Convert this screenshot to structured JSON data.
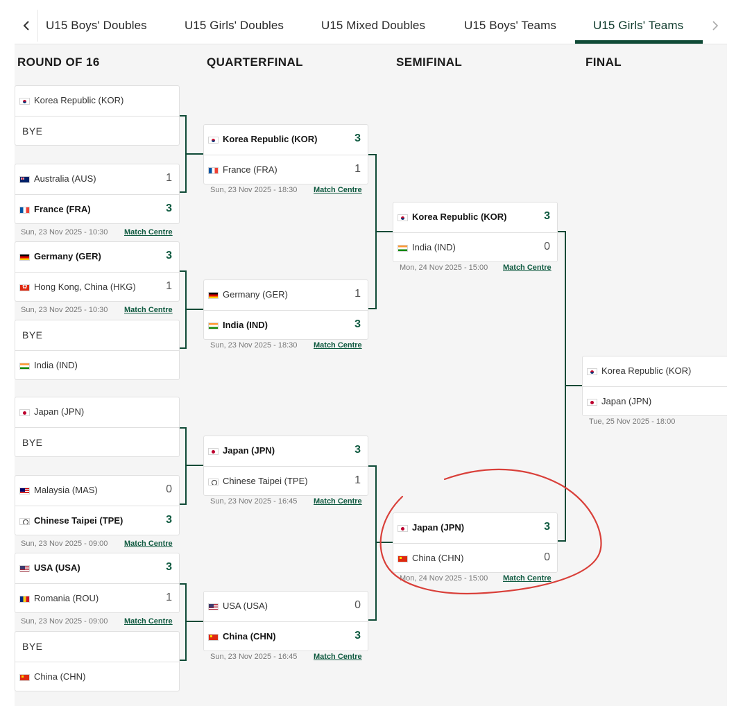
{
  "tabs": {
    "items": [
      {
        "label": "U15 Boys' Doubles",
        "active": false
      },
      {
        "label": "U15 Girls' Doubles",
        "active": false
      },
      {
        "label": "U15 Mixed Doubles",
        "active": false
      },
      {
        "label": "U15 Boys' Teams",
        "active": false
      },
      {
        "label": "U15 Girls' Teams",
        "active": true
      }
    ],
    "prev_icon": "chevron-left-icon",
    "next_icon": "chevron-right-icon"
  },
  "rounds": {
    "r16": "ROUND OF 16",
    "qf": "QUARTERFINAL",
    "sf": "SEMIFINAL",
    "final": "FINAL"
  },
  "match_centre_label": "Match Centre",
  "bye_label": "BYE",
  "r16_matches": [
    {
      "team1": "Korea Republic (KOR)",
      "flag1": "kor",
      "score1": "",
      "team2": "BYE",
      "flag2": "",
      "score2": "",
      "winner": 1,
      "date": "",
      "link": false
    },
    {
      "team1": "Australia (AUS)",
      "flag1": "aus",
      "score1": "1",
      "team2": "France (FRA)",
      "flag2": "fra",
      "score2": "3",
      "winner": 2,
      "date": "Sun, 23 Nov 2025 - 10:30",
      "link": true
    },
    {
      "team1": "Germany (GER)",
      "flag1": "ger",
      "score1": "3",
      "team2": "Hong Kong, China (HKG)",
      "flag2": "hkg",
      "score2": "1",
      "winner": 1,
      "date": "Sun, 23 Nov 2025 - 10:30",
      "link": true
    },
    {
      "team1": "BYE",
      "flag1": "",
      "score1": "",
      "team2": "India (IND)",
      "flag2": "ind",
      "score2": "",
      "winner": 2,
      "date": "",
      "link": false
    },
    {
      "team1": "Japan (JPN)",
      "flag1": "jpn",
      "score1": "",
      "team2": "BYE",
      "flag2": "",
      "score2": "",
      "winner": 1,
      "date": "",
      "link": false
    },
    {
      "team1": "Malaysia (MAS)",
      "flag1": "mas",
      "score1": "0",
      "team2": "Chinese Taipei (TPE)",
      "flag2": "tpe",
      "score2": "3",
      "winner": 2,
      "date": "Sun, 23 Nov 2025 - 09:00",
      "link": true
    },
    {
      "team1": "USA (USA)",
      "flag1": "usa",
      "score1": "3",
      "team2": "Romania (ROU)",
      "flag2": "rou",
      "score2": "1",
      "winner": 1,
      "date": "Sun, 23 Nov 2025 - 09:00",
      "link": true
    },
    {
      "team1": "BYE",
      "flag1": "",
      "score1": "",
      "team2": "China (CHN)",
      "flag2": "chn",
      "score2": "",
      "winner": 2,
      "date": "",
      "link": false
    }
  ],
  "qf_matches": [
    {
      "team1": "Korea Republic (KOR)",
      "flag1": "kor",
      "score1": "3",
      "team2": "France (FRA)",
      "flag2": "fra",
      "score2": "1",
      "winner": 1,
      "date": "Sun, 23 Nov 2025 - 18:30",
      "link": true
    },
    {
      "team1": "Germany (GER)",
      "flag1": "ger",
      "score1": "1",
      "team2": "India (IND)",
      "flag2": "ind",
      "score2": "3",
      "winner": 2,
      "date": "Sun, 23 Nov 2025 - 18:30",
      "link": true
    },
    {
      "team1": "Japan (JPN)",
      "flag1": "jpn",
      "score1": "3",
      "team2": "Chinese Taipei (TPE)",
      "flag2": "tpe",
      "score2": "1",
      "winner": 1,
      "date": "Sun, 23 Nov 2025 - 16:45",
      "link": true
    },
    {
      "team1": "USA (USA)",
      "flag1": "usa",
      "score1": "0",
      "team2": "China (CHN)",
      "flag2": "chn",
      "score2": "3",
      "winner": 2,
      "date": "Sun, 23 Nov 2025 - 16:45",
      "link": true
    }
  ],
  "sf_matches": [
    {
      "team1": "Korea Republic (KOR)",
      "flag1": "kor",
      "score1": "3",
      "team2": "India (IND)",
      "flag2": "ind",
      "score2": "0",
      "winner": 1,
      "date": "Mon, 24 Nov 2025 - 15:00",
      "link": true
    },
    {
      "team1": "Japan (JPN)",
      "flag1": "jpn",
      "score1": "3",
      "team2": "China (CHN)",
      "flag2": "chn",
      "score2": "0",
      "winner": 1,
      "date": "Mon, 24 Nov 2025 - 15:00",
      "link": true
    }
  ],
  "final_match": {
    "team1": "Korea Republic (KOR)",
    "flag1": "kor",
    "score1": "",
    "team2": "Japan (JPN)",
    "flag2": "jpn",
    "score2": "",
    "winner": 0,
    "date": "Tue, 25 Nov 2025 - 18:00",
    "link": false
  },
  "colors": {
    "accent": "#0f4a36",
    "win_score": "#0f5a40",
    "annotation": "#d9403a"
  }
}
